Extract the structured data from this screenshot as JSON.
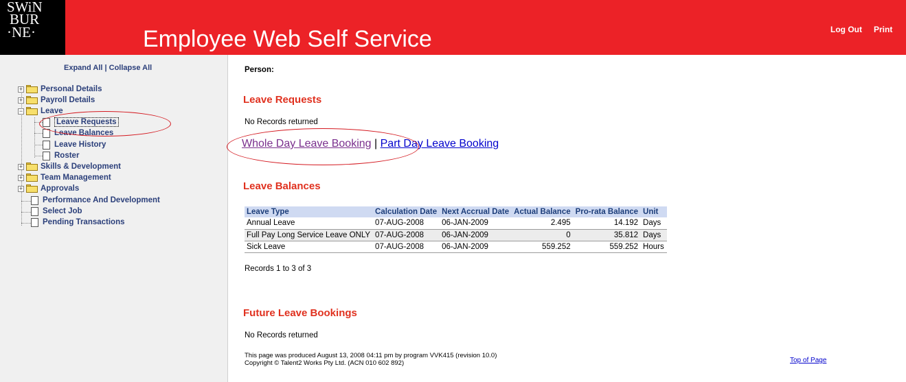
{
  "header": {
    "logo_lines": [
      "SWiN",
      "BUR",
      "·NE·"
    ],
    "title": "Employee Web Self Service",
    "logout": "Log Out",
    "print": "Print"
  },
  "sidebar": {
    "expand_all": "Expand All",
    "separator": " | ",
    "collapse_all": "Collapse All",
    "items": [
      {
        "label": "Personal Details"
      },
      {
        "label": "Payroll Details"
      },
      {
        "label": "Leave"
      },
      {
        "label": "Leave Requests"
      },
      {
        "label": "Leave Balances"
      },
      {
        "label": "Leave History"
      },
      {
        "label": "Roster"
      },
      {
        "label": "Skills & Development"
      },
      {
        "label": "Team Management"
      },
      {
        "label": "Approvals"
      },
      {
        "label": "Performance And Development"
      },
      {
        "label": "Select Job"
      },
      {
        "label": "Pending Transactions"
      }
    ]
  },
  "main": {
    "person_label": "Person:",
    "leave_requests": {
      "heading": "Leave Requests",
      "empty_text": "No Records returned",
      "whole_day_link": "Whole Day Leave Booking",
      "link_separator": "|",
      "part_day_link": "Part Day Leave Booking"
    },
    "leave_balances": {
      "heading": "Leave Balances",
      "columns": [
        "Leave Type",
        "Calculation Date",
        "Next Accrual Date",
        "Actual Balance",
        "Pro-rata Balance",
        "Unit"
      ],
      "rows": [
        [
          "Annual Leave",
          "07-AUG-2008",
          "06-JAN-2009",
          "2.495",
          "14.192",
          "Days"
        ],
        [
          "Full Pay Long Service Leave ONLY",
          "07-AUG-2008",
          "06-JAN-2009",
          "0",
          "35.812",
          "Days"
        ],
        [
          "Sick Leave",
          "07-AUG-2008",
          "06-JAN-2009",
          "559.252",
          "559.252",
          "Hours"
        ]
      ],
      "records_text": "Records 1 to 3 of 3"
    },
    "future_bookings": {
      "heading": "Future Leave Bookings",
      "empty_text": "No Records returned"
    },
    "footer_line1": "This page was produced August 13, 2008 04:11 pm by program VVK415 (revision 10.0)",
    "footer_line2": "Copyright © Talent2 Works Pty Ltd. (ACN 010 602 892)",
    "top_of_page": "Top of Page"
  }
}
